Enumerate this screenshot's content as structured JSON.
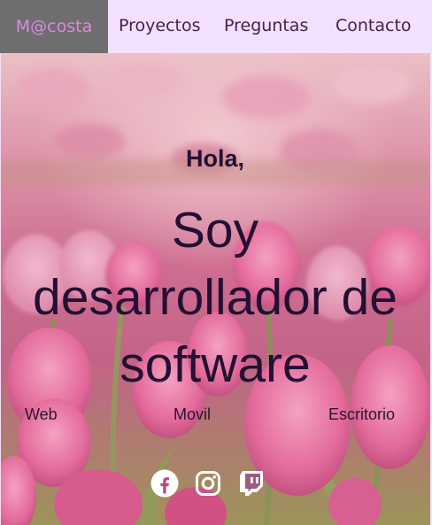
{
  "nav": {
    "brand": "M@costa",
    "items": [
      "Proyectos",
      "Preguntas",
      "Contacto"
    ]
  },
  "hero": {
    "greeting": "Hola,",
    "headline_lines": [
      "Soy",
      "desarrollador de",
      "software"
    ],
    "tags": [
      "Web",
      "Movil",
      "Escritorio"
    ]
  },
  "social": [
    {
      "icon": "facebook-icon"
    },
    {
      "icon": "instagram-icon"
    },
    {
      "icon": "twitch-icon"
    }
  ],
  "colors": {
    "nav_bg": "#f4e1ff",
    "brand_bg": "#6f6d6f",
    "brand_text": "#d98be0",
    "nav_text": "#40234a",
    "hero_text": "#231032"
  }
}
